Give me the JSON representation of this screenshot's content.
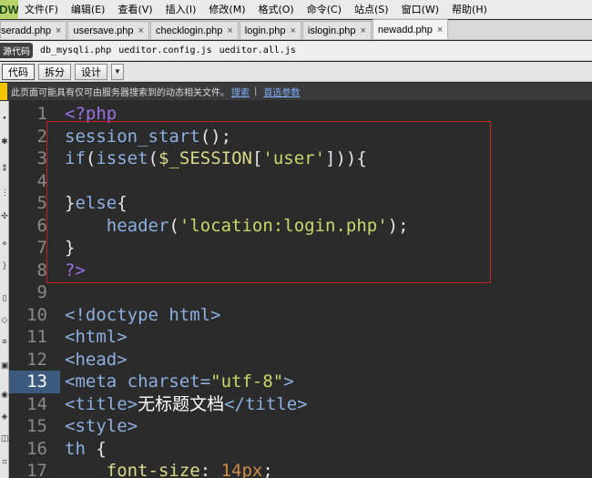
{
  "menubar": {
    "logo": "DW",
    "items": [
      "文件(F)",
      "编辑(E)",
      "查看(V)",
      "插入(I)",
      "修改(M)",
      "格式(O)",
      "命令(C)",
      "站点(S)",
      "窗口(W)",
      "帮助(H)"
    ]
  },
  "tabs": [
    {
      "label": "seradd.php",
      "close": "×"
    },
    {
      "label": "usersave.php",
      "close": "×"
    },
    {
      "label": "checklogin.php",
      "close": "×"
    },
    {
      "label": "login.php",
      "close": "×"
    },
    {
      "label": "islogin.php",
      "close": "×"
    },
    {
      "label": "newadd.php",
      "close": "×"
    }
  ],
  "related_files": {
    "badge": "源代码",
    "files": [
      "db_mysqli.php",
      "ueditor.config.js",
      "ueditor.all.js"
    ]
  },
  "view_buttons": {
    "code": "代码",
    "split": "拆分",
    "design": "设计",
    "dropdown": "▼"
  },
  "infobar": {
    "message": "此页面可能具有仅可由服务器搜索到的动态相关文件。",
    "link_discover": "搜索",
    "separator": "|",
    "link_prefs": "首选参数"
  },
  "editor": {
    "current_line": 13,
    "line_numbers": [
      "1",
      "2",
      "3",
      "4",
      "5",
      "6",
      "7",
      "8",
      "9",
      "10",
      "11",
      "12",
      "13",
      "14",
      "15",
      "16",
      "17"
    ],
    "colors": {
      "background": "#2b2b2b",
      "highlight_box": "#c81e1e",
      "current_line": "#3c5a7e"
    }
  },
  "code": {
    "l1": {
      "open": "<?php"
    },
    "l2": {
      "fn": "session_start",
      "rest": "();"
    },
    "l3": {
      "kw_if": "if",
      "p1": "(",
      "fn": "isset",
      "p2": "(",
      "var": "$_SESSION",
      "p3": "[",
      "str": "'user'",
      "p4": "])){"
    },
    "l4": {
      "text": ""
    },
    "l5": {
      "p1": "}",
      "kw": "else",
      "p2": "{"
    },
    "l6": {
      "indent": "    ",
      "fn": "header",
      "p1": "(",
      "str": "'location:login.php'",
      "p2": ");"
    },
    "l7": {
      "text": "}"
    },
    "l8": {
      "close": "?>"
    },
    "l9": {
      "text": ""
    },
    "l10": {
      "text": "<!doctype html>"
    },
    "l11": {
      "text": "<html>"
    },
    "l12": {
      "text": "<head>"
    },
    "l13": {
      "tag_open": "<meta ",
      "attr": "charset=",
      "val": "\"utf-8\"",
      "tag_close": ">"
    },
    "l14": {
      "tag_open": "<title>",
      "txt": "无标题文档",
      "tag_close": "</title>"
    },
    "l15": {
      "text": "<style>"
    },
    "l16": {
      "sel": "th ",
      "brace": "{"
    },
    "l17": {
      "indent": "    ",
      "prop": "font-size",
      "colon": ": ",
      "num": "14px",
      "semi": ";"
    }
  }
}
